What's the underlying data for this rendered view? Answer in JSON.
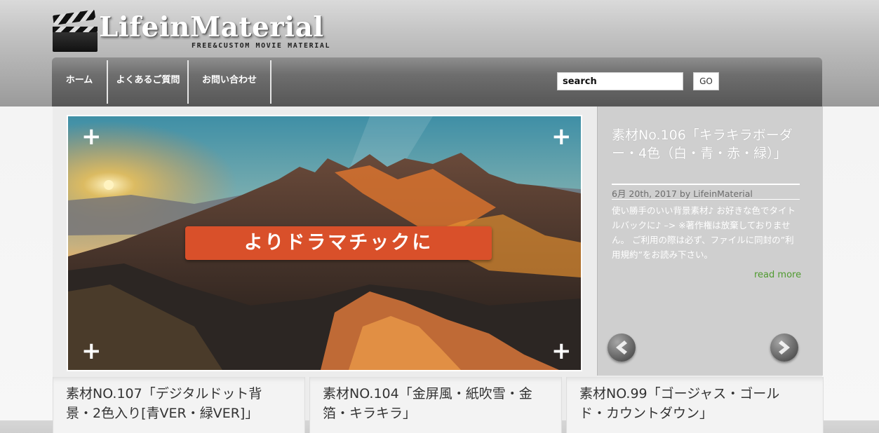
{
  "header": {
    "logo_title": "LifeinMaterial",
    "logo_subtitle": "FREE&CUSTOM MOVIE MATERIAL"
  },
  "nav": {
    "items": [
      {
        "label": "ホーム"
      },
      {
        "label": "よくあるご質問"
      },
      {
        "label": "お問い合わせ"
      }
    ],
    "search_value": "search",
    "go_label": "GO"
  },
  "slider": {
    "banner_text": "よりドラマチックに",
    "corner_symbol": "+"
  },
  "featured_post": {
    "title": "素材No.106「キラキラボーダー・4色（白・青・赤・緑）」",
    "meta": "6月 20th, 2017 by LifeinMaterial",
    "excerpt": "使い勝手のいい背景素材♪ お好きな色でタイトルバックに♪ –> ※著作権は放棄しておりません。 ご利用の際は必ず、ファイルに同封の”利用規約”をお読み下さい。",
    "read_more": "read more"
  },
  "cards": [
    {
      "title": "素材NO.107「デジタルドット背景・2色入り[青VER・緑VER]」"
    },
    {
      "title": "素材NO.104「金屏風・紙吹雪・金箔・キラキラ」"
    },
    {
      "title": "素材NO.99「ゴージャス・ゴールド・カウントダウン」"
    }
  ],
  "colors": {
    "banner": "#d9502a",
    "read_more": "#4f9a2f",
    "navbar": "#5a5a5a"
  }
}
